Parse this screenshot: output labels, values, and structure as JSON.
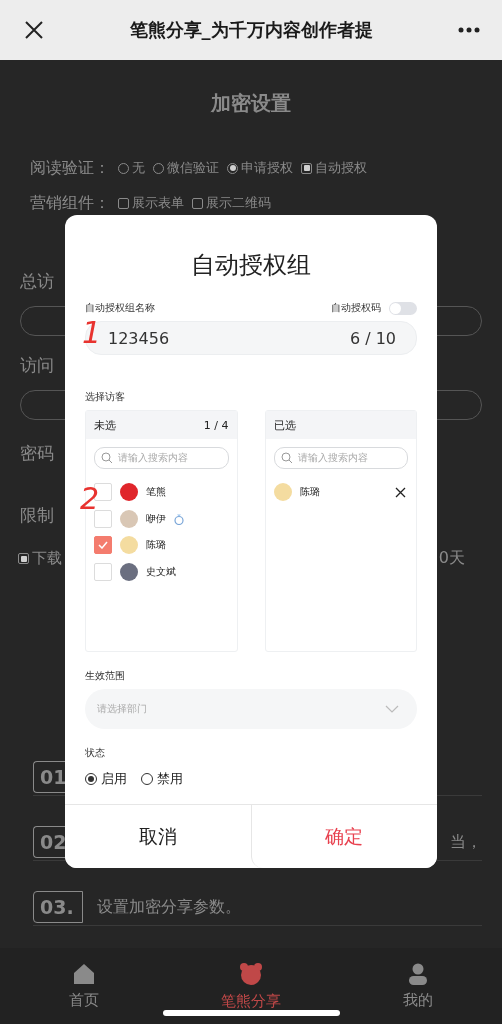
{
  "top_bar": {
    "title": "笔熊分享_为千万内容创作者提"
  },
  "page": {
    "heading": "加密设置",
    "settings": [
      {
        "label": "阅读验证：",
        "options": [
          {
            "kind": "radio",
            "label": "无",
            "selected": false
          },
          {
            "kind": "radio",
            "label": "微信验证",
            "selected": false
          },
          {
            "kind": "radio",
            "label": "申请授权",
            "selected": true
          },
          {
            "kind": "checkbox",
            "label": "自动授权",
            "checked": true
          }
        ]
      },
      {
        "label": "营销组件：",
        "options": [
          {
            "kind": "checkbox",
            "label": "展示表单",
            "checked": false
          },
          {
            "kind": "checkbox",
            "label": "展示二维码",
            "checked": false
          }
        ]
      }
    ],
    "fields": [
      {
        "label": "总访"
      },
      {
        "label": "访问"
      }
    ],
    "password_label": "密码",
    "limit_label": "限制",
    "download": {
      "label": "下载",
      "checked": true,
      "tail": "0天"
    },
    "steps": [
      {
        "number": "01"
      },
      {
        "number": "02",
        "tail": "当，"
      },
      {
        "number": "03.",
        "text": "设置加密分享参数。"
      }
    ]
  },
  "dialog": {
    "title": "自动授权组",
    "name_label": "自动授权组名称",
    "code_label": "自动授权码",
    "code_on": false,
    "name_value": "123456",
    "name_counter": "6 / 10",
    "visitors_label": "选择访客",
    "unselected": {
      "title": "未选",
      "count": "1 / 4",
      "placeholder": "请输入搜索内容",
      "items": [
        {
          "name": "笔熊",
          "checked": false,
          "ring": false
        },
        {
          "name": "咿伊",
          "checked": false,
          "ring": true
        },
        {
          "name": "陈璐",
          "checked": true,
          "ring": false
        },
        {
          "name": "史文斌",
          "checked": false,
          "ring": false
        }
      ]
    },
    "selected": {
      "title": "已选",
      "placeholder": "请输入搜索内容",
      "items": [
        {
          "name": "陈璐"
        }
      ]
    },
    "scope_label": "生效范围",
    "scope_placeholder": "请选择部门",
    "status_label": "状态",
    "status_options": [
      {
        "label": "启用",
        "selected": true
      },
      {
        "label": "禁用",
        "selected": false
      }
    ],
    "cancel": "取消",
    "confirm": "确定"
  },
  "annotations": [
    "1",
    "2"
  ],
  "tab_bar": [
    {
      "label": "首页",
      "selected": false
    },
    {
      "label": "笔熊分享",
      "selected": true
    },
    {
      "label": "我的",
      "selected": false
    }
  ]
}
